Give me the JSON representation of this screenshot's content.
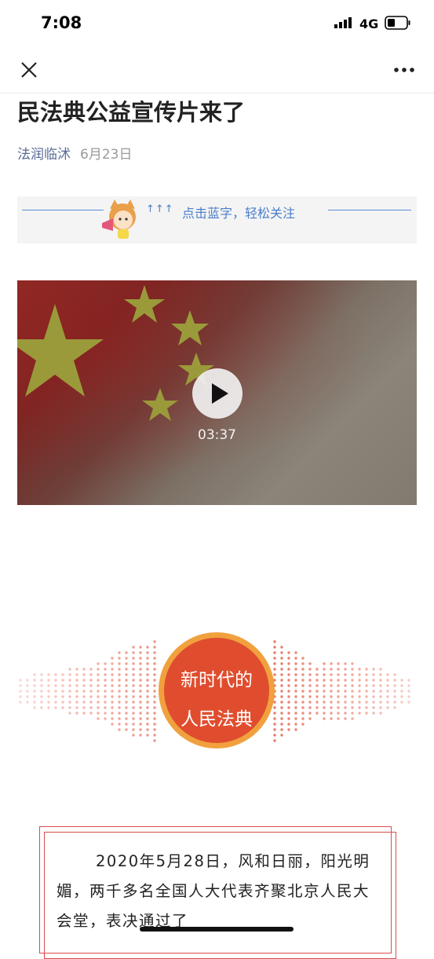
{
  "status": {
    "time": "7:08",
    "network": "4G"
  },
  "nav": {
    "close_icon": "close-icon",
    "more_icon": "more-icon"
  },
  "article": {
    "title": "民法典公益宣传片来了",
    "author": "法润临沭",
    "date": "6月23日"
  },
  "banner": {
    "text": "点击蓝字，轻松关注"
  },
  "video": {
    "duration": "03:37"
  },
  "emblem": {
    "line1": "新时代的",
    "line2": "人民法典"
  },
  "body": {
    "paragraph": "2020年5月28日，风和日丽，阳光明媚，两千多名全国人大代表齐聚北京人民大会堂，表决通过了"
  },
  "colors": {
    "link": "#576b95",
    "accent_red": "#e04d2e",
    "accent_orange": "#f0a13e"
  }
}
